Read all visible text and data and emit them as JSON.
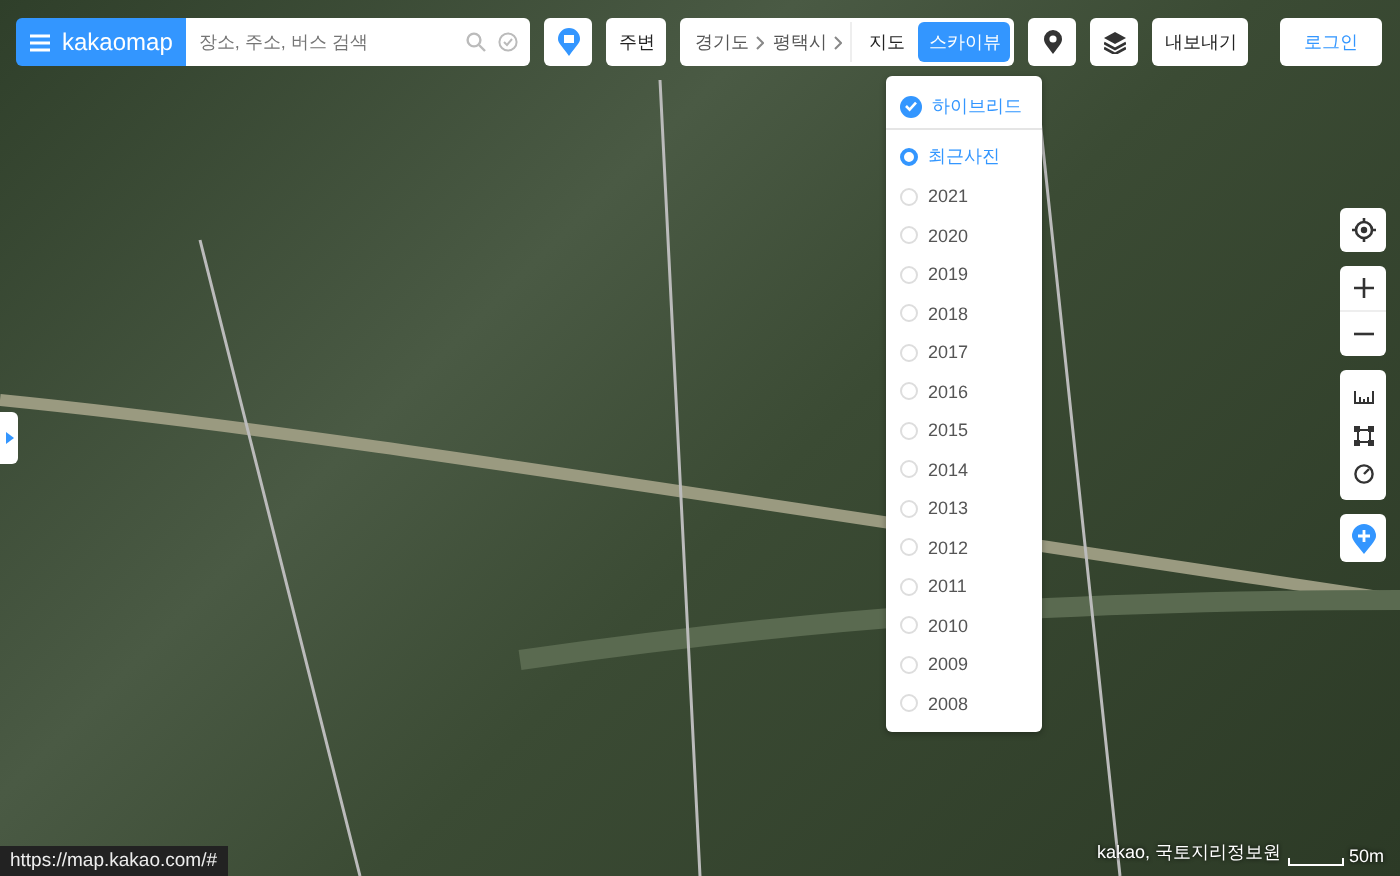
{
  "search": {
    "logo": "kakaomap",
    "placeholder": "장소, 주소, 버스 검색"
  },
  "nearby_button": "주변",
  "breadcrumb": [
    "경기도",
    "평택시"
  ],
  "map_types": [
    {
      "label": "지도",
      "selected": false
    },
    {
      "label": "스카이뷰",
      "selected": true
    }
  ],
  "export_button": "내보내기",
  "login_button": "로그인",
  "skyview_menu": {
    "hybrid": {
      "label": "하이브리드",
      "checked": true
    },
    "years": [
      {
        "label": "최근사진",
        "selected": true
      },
      {
        "label": "2021",
        "selected": false
      },
      {
        "label": "2020",
        "selected": false
      },
      {
        "label": "2019",
        "selected": false
      },
      {
        "label": "2018",
        "selected": false
      },
      {
        "label": "2017",
        "selected": false
      },
      {
        "label": "2016",
        "selected": false
      },
      {
        "label": "2015",
        "selected": false
      },
      {
        "label": "2014",
        "selected": false
      },
      {
        "label": "2013",
        "selected": false
      },
      {
        "label": "2012",
        "selected": false
      },
      {
        "label": "2011",
        "selected": false
      },
      {
        "label": "2010",
        "selected": false
      },
      {
        "label": "2009",
        "selected": false
      },
      {
        "label": "2008",
        "selected": false
      }
    ]
  },
  "status_url": "https://map.kakao.com/#",
  "attribution": "kakao, 국토지리정보원",
  "scale": "50m"
}
